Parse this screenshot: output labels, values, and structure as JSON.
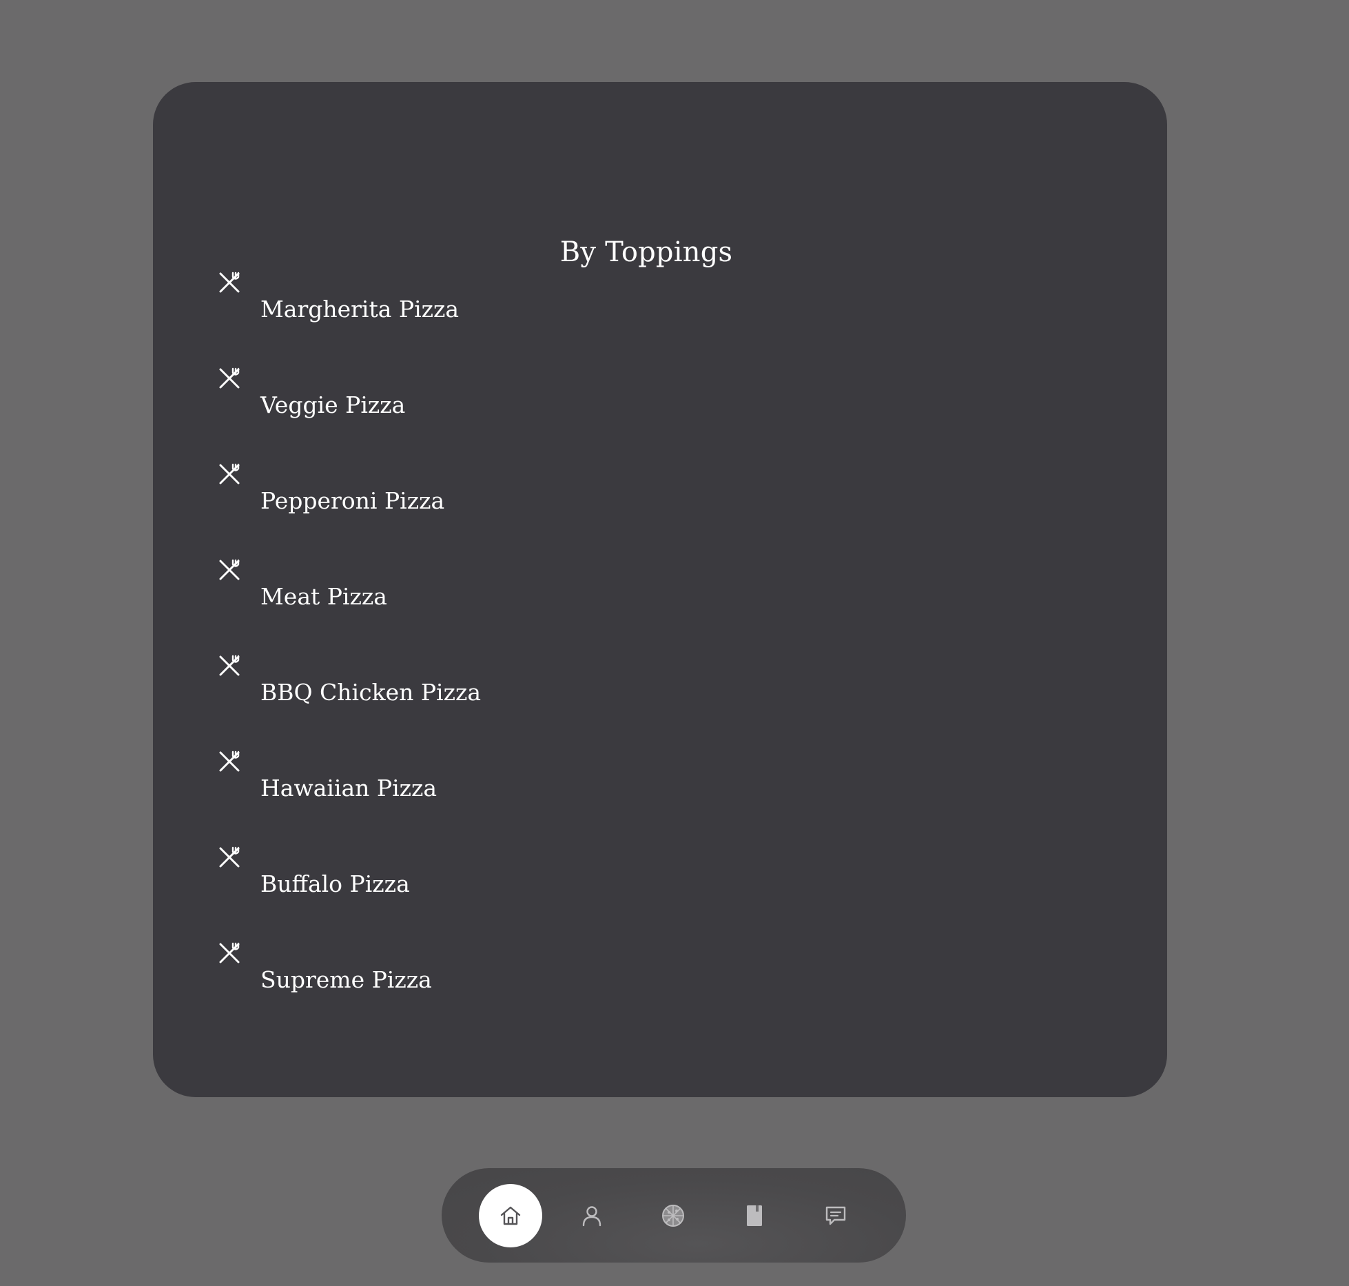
{
  "page": {
    "title": "By Toppings"
  },
  "menu": {
    "items": [
      {
        "label": "Margherita Pizza",
        "icon": "fork-knife-icon"
      },
      {
        "label": "Veggie Pizza",
        "icon": "fork-knife-icon"
      },
      {
        "label": "Pepperoni Pizza",
        "icon": "fork-knife-icon"
      },
      {
        "label": "Meat Pizza",
        "icon": "fork-knife-icon"
      },
      {
        "label": "BBQ Chicken Pizza",
        "icon": "fork-knife-icon"
      },
      {
        "label": "Hawaiian Pizza",
        "icon": "fork-knife-icon"
      },
      {
        "label": "Buffalo Pizza",
        "icon": "fork-knife-icon"
      },
      {
        "label": "Supreme Pizza",
        "icon": "fork-knife-icon"
      }
    ]
  },
  "bottom_nav": {
    "items": [
      {
        "icon": "home-icon",
        "active": true
      },
      {
        "icon": "user-icon",
        "active": false
      },
      {
        "icon": "pizza-icon",
        "active": false
      },
      {
        "icon": "book-icon",
        "active": false
      },
      {
        "icon": "chat-icon",
        "active": false
      }
    ]
  },
  "colors": {
    "background": "#6b6a6b",
    "card": "#3b3a3f",
    "text": "#ffffff",
    "nav_bar": "#4a494b",
    "nav_active": "#ffffff",
    "nav_icon": "#bdbcbe",
    "nav_icon_active": "#555457"
  }
}
